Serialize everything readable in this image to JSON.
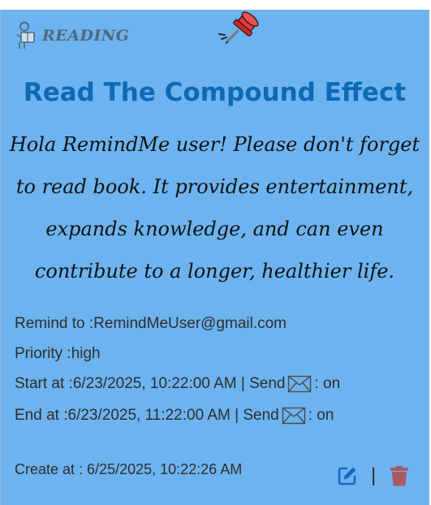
{
  "category": {
    "label": "READING",
    "icon": "book-reader-icon"
  },
  "pin_icon": "pushpin-icon",
  "title": "Read The Compound Effect",
  "message": "Hola RemindMe user! Please don't forget to read book. It provides entertainment, expands knowledge, and can even contribute to a longer, healthier life.",
  "details": {
    "remind_to_label": "Remind to : ",
    "remind_to_value": "RemindMeUser@gmail.com",
    "priority_label": "Priority : ",
    "priority_value": "high",
    "start_label": "Start at : ",
    "start_value": "6/23/2025, 10:22:00 AM | Send",
    "start_status": ": on",
    "end_label": "End at : ",
    "end_value": "6/23/2025, 11:22:00 AM | Send",
    "end_status": ": on"
  },
  "footer": {
    "created_label": "Create at : ",
    "created_value": "6/25/2025, 10:22:26 AM",
    "divider": "|"
  },
  "colors": {
    "card_bg": "#6db3ef",
    "title": "#0d6ab4",
    "edit": "#1669c1",
    "delete": "#a85a63",
    "pin": "#e63b3b"
  }
}
